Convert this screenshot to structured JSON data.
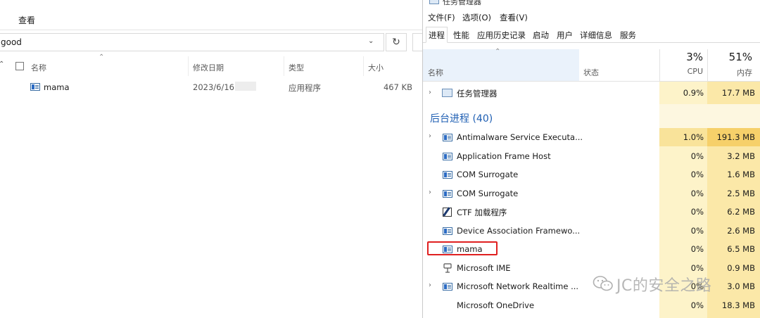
{
  "explorer": {
    "menu_view": "查看",
    "address_text": "good",
    "columns": {
      "name": "名称",
      "modified": "修改日期",
      "type": "类型",
      "size": "大小"
    },
    "files": [
      {
        "name": "mama",
        "modified": "2023/6/16",
        "type": "应用程序",
        "size": "467 KB"
      }
    ]
  },
  "taskmanager": {
    "title": "任务管理器",
    "menu": [
      "文件(F)",
      "选项(O)",
      "查看(V)"
    ],
    "tabs": [
      "进程",
      "性能",
      "应用历史记录",
      "启动",
      "用户",
      "详细信息",
      "服务"
    ],
    "active_tab": "进程",
    "header": {
      "name": "名称",
      "status": "状态",
      "cpu_pct": "3%",
      "cpu_label": "CPU",
      "mem_pct": "51%",
      "mem_label": "内存"
    },
    "app_row": {
      "name": "任务管理器",
      "cpu": "0.9%",
      "mem": "17.7 MB",
      "icon": "task-manager-icon"
    },
    "background_group": "后台进程 (40)",
    "processes": [
      {
        "name": "Antimalware Service Executa...",
        "cpu": "1.0%",
        "mem": "191.3 MB",
        "expand": true,
        "icon": "app-window-icon"
      },
      {
        "name": "Application Frame Host",
        "cpu": "0%",
        "mem": "3.2 MB",
        "expand": false,
        "icon": "app-window-icon"
      },
      {
        "name": "COM Surrogate",
        "cpu": "0%",
        "mem": "1.6 MB",
        "expand": false,
        "icon": "app-window-icon"
      },
      {
        "name": "COM Surrogate",
        "cpu": "0%",
        "mem": "2.5 MB",
        "expand": true,
        "icon": "app-window-icon"
      },
      {
        "name": "CTF 加载程序",
        "cpu": "0%",
        "mem": "6.2 MB",
        "expand": false,
        "icon": "ctf-loader-icon"
      },
      {
        "name": "Device Association Framewo...",
        "cpu": "0%",
        "mem": "2.6 MB",
        "expand": false,
        "icon": "app-window-icon"
      },
      {
        "name": "mama",
        "cpu": "0%",
        "mem": "6.5 MB",
        "expand": false,
        "icon": "app-window-icon"
      },
      {
        "name": "Microsoft IME",
        "cpu": "0%",
        "mem": "0.9 MB",
        "expand": false,
        "icon": "ime-icon"
      },
      {
        "name": "Microsoft Network Realtime ...",
        "cpu": "0%",
        "mem": "3.0 MB",
        "expand": true,
        "icon": "app-window-icon"
      },
      {
        "name": "Microsoft OneDrive",
        "cpu": "0%",
        "mem": "18.3 MB",
        "expand": false,
        "icon": "none"
      }
    ]
  },
  "watermark": {
    "text": "JC的安全之路"
  }
}
